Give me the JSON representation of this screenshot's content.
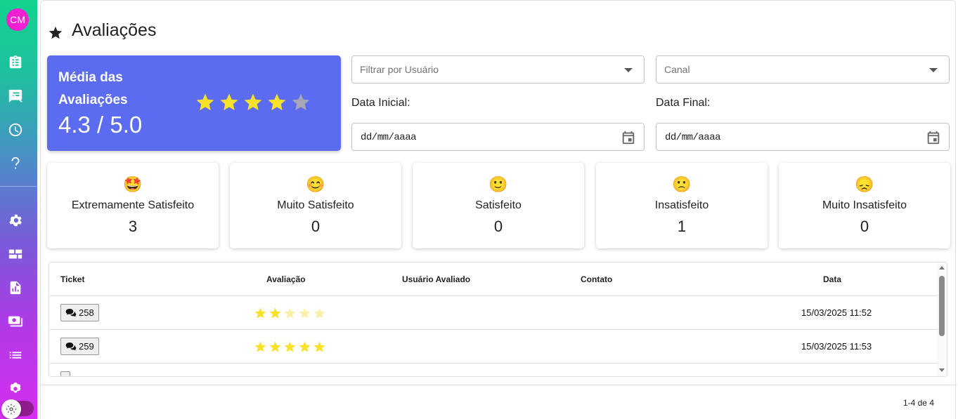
{
  "sidebar": {
    "avatar_initials": "CM",
    "items": [
      {
        "icon": "clipboard-list-icon"
      },
      {
        "icon": "chat-off-icon"
      },
      {
        "icon": "clock-icon"
      },
      {
        "icon": "help-icon"
      },
      {
        "icon": "gear-icon"
      },
      {
        "icon": "dashboard-icon"
      },
      {
        "icon": "report-icon"
      },
      {
        "icon": "money-icon"
      },
      {
        "icon": "list-icon"
      },
      {
        "icon": "flower-settings-icon"
      }
    ],
    "theme_toggle_icon": "sun-icon"
  },
  "header": {
    "title": "Avaliações",
    "icon": "star-icon"
  },
  "summary": {
    "label": "Média das Avaliações",
    "value": "4.3 / 5.0",
    "rating": 4.3,
    "max_rating": 5,
    "card_color": "#5b6cf0"
  },
  "filters": {
    "user_placeholder": "Filtrar por Usuário",
    "channel_placeholder": "Canal",
    "start_date_label": "Data Inicial:",
    "end_date_label": "Data Final:",
    "start_date_placeholder": "dd/mm/aaaa",
    "end_date_placeholder": "dd/mm/aaaa"
  },
  "satisfaction": [
    {
      "emoji": "🤩",
      "label": "Extremamente Satisfeito",
      "count": "3"
    },
    {
      "emoji": "😊",
      "label": "Muito Satisfeito",
      "count": "0"
    },
    {
      "emoji": "🙂",
      "label": "Satisfeito",
      "count": "0"
    },
    {
      "emoji": "🙁",
      "label": "Insatisfeito",
      "count": "1"
    },
    {
      "emoji": "😞",
      "label": "Muito Insatisfeito",
      "count": "0"
    }
  ],
  "table": {
    "columns": [
      "Ticket",
      "Avaliação",
      "Usuário Avaliado",
      "Contato",
      "Data"
    ],
    "rows": [
      {
        "ticket": "258",
        "rating": 2,
        "user": "",
        "contact": "",
        "date": "15/03/2025 11:52"
      },
      {
        "ticket": "259",
        "rating": 5,
        "user": "",
        "contact": "",
        "date": "15/03/2025 11:53"
      }
    ]
  },
  "pagination": {
    "text": "1-4 de 4"
  },
  "colors": {
    "star_filled": "#f7e12a",
    "star_empty": "#a6a6b8",
    "star_faded": "#f9f0a8"
  }
}
